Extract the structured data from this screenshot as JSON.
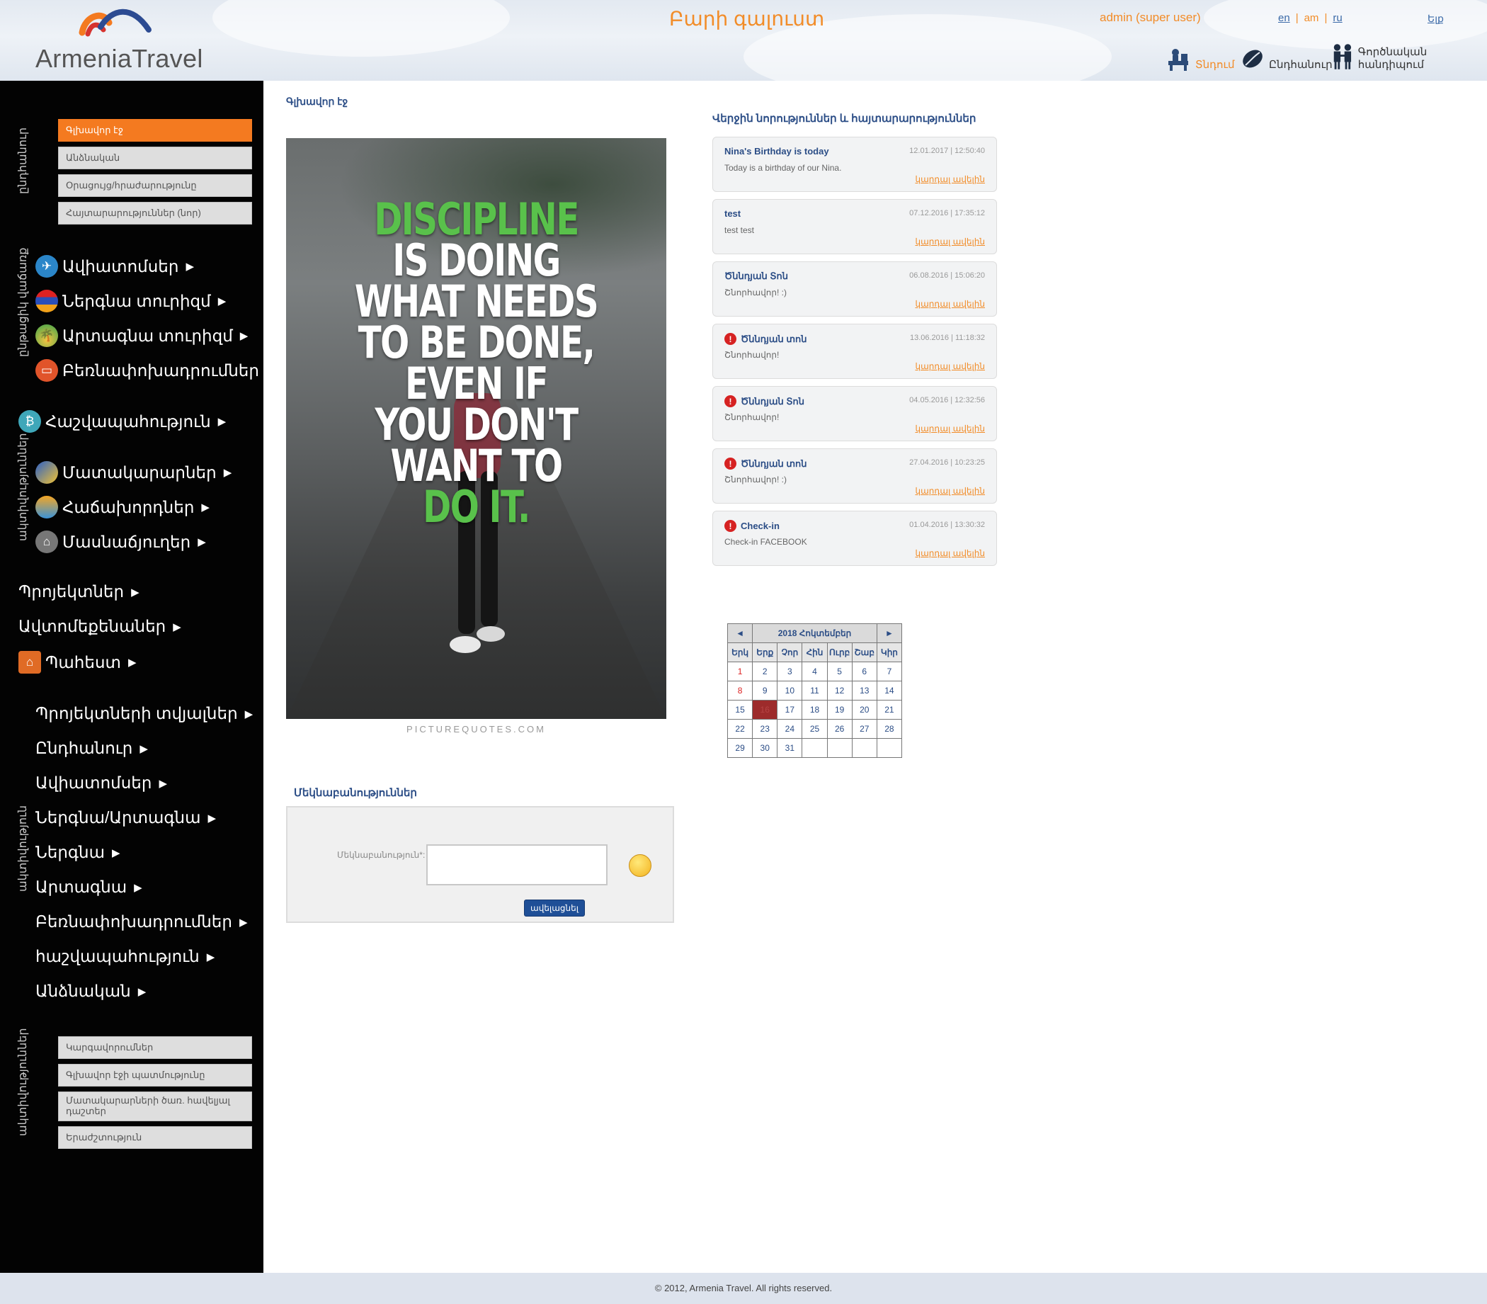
{
  "header": {
    "logo_text": "ArmeniaTravel",
    "welcome": "Բարի գալուստ",
    "user": "admin (super user)",
    "langs": [
      "en",
      "am",
      "ru"
    ],
    "exit": "Ելք",
    "nav": {
      "home": "Տնդում",
      "general": "Ընդհանուր",
      "partners": "Գործնական հանդիպում"
    }
  },
  "sidebar": {
    "sections": {
      "s1": "ընդհանուր",
      "s2": "ընթացիկ վաճառք",
      "s3": "ակտիվություններ",
      "s4": "ակտիվություն",
      "s5": "ակտիվություններ"
    },
    "top_buttons": [
      "Գլխավոր էջ",
      "Անձնական",
      "Օրացույց/հրաժարությունը",
      "Հայտարարություններ (նոր)"
    ],
    "group1": [
      "Ավիատոմսեր",
      "Ներգնա տուրիզմ",
      "Արտագնա տուրիզմ",
      "Բեռնափոխադրումներ"
    ],
    "group2": [
      "Հաշվապահություն"
    ],
    "group3": [
      "Մատակարարներ",
      "Հաճախորդներ",
      "Մասնաճյուղեր"
    ],
    "group4": [
      "Պրոյեկտներ",
      "Ավտոմեքենաներ",
      "Պահեստ"
    ],
    "group5": [
      "Պրոյեկտների տվյալներ",
      "Ընդհանուր",
      "Ավիատոմսեր",
      "Ներգնա/Արտագնա",
      "Ներգնա",
      "Արտագնա",
      "Բեռնափոխադրումներ",
      "հաշվապահություն",
      "Անձնական"
    ],
    "bottom_buttons": [
      "Կարգավորումներ",
      "Գլխավոր էջի պատմությունը",
      "Մատակարարների ծառ. հավելյալ դաշտեր",
      "Երաժշտություն"
    ],
    "arrow": "▶"
  },
  "main": {
    "breadcrumb": "Գլխավոր էջ",
    "poster": {
      "line1": "DISCIPLINE",
      "lines": [
        "IS DOING",
        "WHAT NEEDS",
        "TO BE DONE,",
        "EVEN IF",
        "YOU DON'T",
        "WANT TO"
      ],
      "last": "DO IT.",
      "credit": "PICTUREQUOTES.COM"
    },
    "comments": {
      "title": "Մեկնաբանություններ",
      "label": "Մեկնաբանություն*:",
      "submit": "ավելացնել"
    }
  },
  "news": {
    "title": "Վերջին նորություններ և հայտարարություններ",
    "more": "կարդալ ավելին",
    "items": [
      {
        "title": "Nina's Birthday is today",
        "date": "12.01.2017  |  12:50:40",
        "body": "Today is a birthday of our Nina.",
        "alert": false
      },
      {
        "title": "test",
        "date": "07.12.2016  |  17:35:12",
        "body": "test test",
        "alert": false
      },
      {
        "title": "Ծննդյան Տոն",
        "date": "06.08.2016  |  15:06:20",
        "body": "Շնորհավոր! :)",
        "alert": false
      },
      {
        "title": "Ծննդյան տոն",
        "date": "13.06.2016  |  11:18:32",
        "body": "Շնորհավոր!",
        "alert": true
      },
      {
        "title": "Ծննդյան Տոն",
        "date": "04.05.2016  |  12:32:56",
        "body": "Շնորհավոր!",
        "alert": true
      },
      {
        "title": "Ծննդյան տոն",
        "date": "27.04.2016  |  10:23:25",
        "body": "Շնորհավոր! :)",
        "alert": true
      },
      {
        "title": "Check-in",
        "date": "01.04.2016  |  13:30:32",
        "body": "Check-in FACEBOOK",
        "alert": true
      }
    ]
  },
  "calendar": {
    "title": "2018 Հոկտեմբեր",
    "prev": "◄",
    "next": "►",
    "days": [
      "Երկ",
      "Երք",
      "Չոր",
      "Հին",
      "Ուրբ",
      "Շաբ",
      "Կիր"
    ],
    "weeks": [
      [
        "1",
        "2",
        "3",
        "4",
        "5",
        "6",
        "7"
      ],
      [
        "8",
        "9",
        "10",
        "11",
        "12",
        "13",
        "14"
      ],
      [
        "15",
        "16",
        "17",
        "18",
        "19",
        "20",
        "21"
      ],
      [
        "22",
        "23",
        "24",
        "25",
        "26",
        "27",
        "28"
      ],
      [
        "29",
        "30",
        "31",
        "",
        "",
        "",
        ""
      ]
    ],
    "today": "16"
  },
  "footer": {
    "text": "© 2012, Armenia Travel. All rights reserved."
  },
  "colors": {
    "accent": "#f47a20",
    "link": "#2b4d86",
    "sidebar": "#030303",
    "alert": "#d62222"
  }
}
